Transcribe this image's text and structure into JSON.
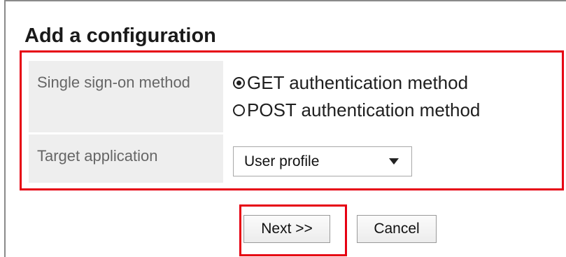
{
  "page": {
    "title": "Add a configuration"
  },
  "form": {
    "method": {
      "label": "Single sign-on method",
      "options": [
        {
          "label": "GET authentication method",
          "checked": true
        },
        {
          "label": "POST authentication method",
          "checked": false
        }
      ]
    },
    "target": {
      "label": "Target application",
      "selected": "User profile"
    }
  },
  "buttons": {
    "next": "Next >>",
    "cancel": "Cancel"
  },
  "colors": {
    "highlight": "#e60012",
    "label_bg": "#eeeeee"
  }
}
